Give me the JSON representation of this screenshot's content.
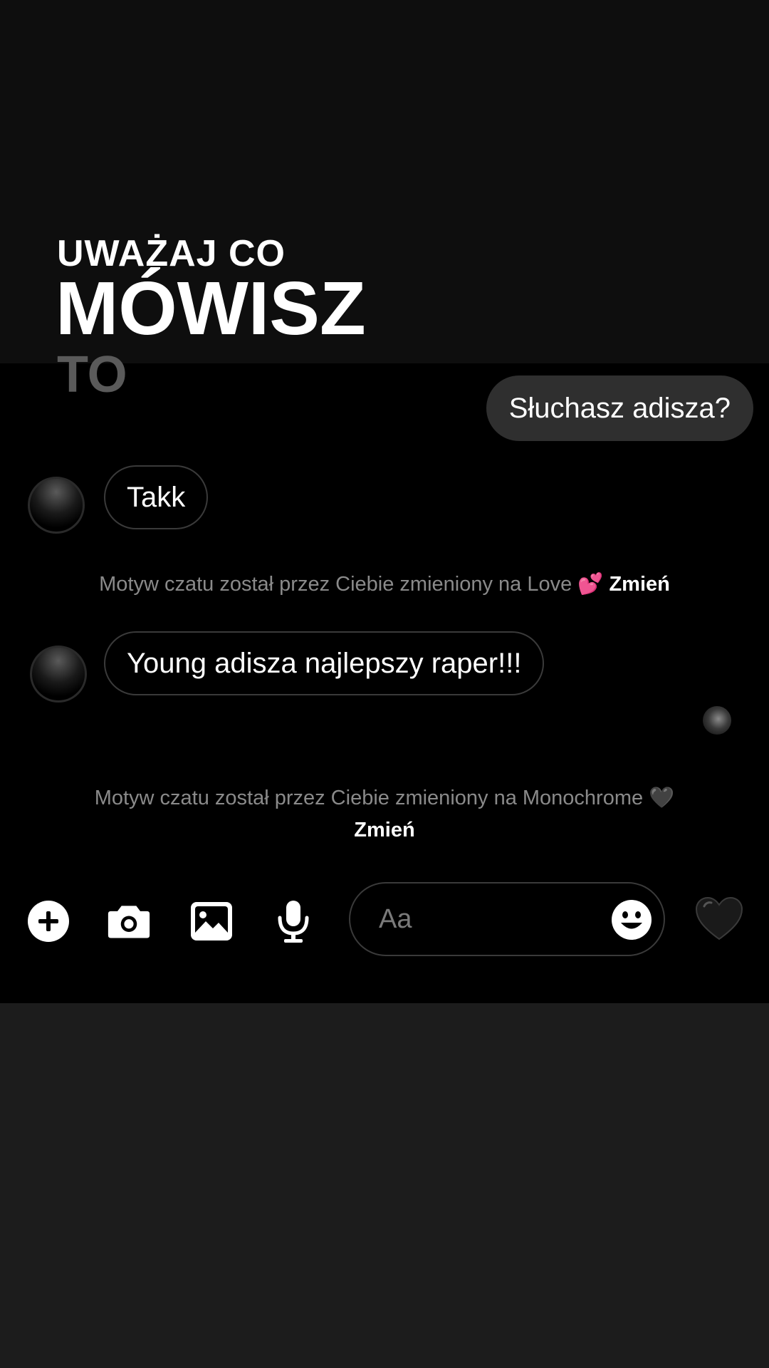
{
  "overlay": {
    "line1": "UWAŻAJ CO",
    "line2": "MÓWISZ",
    "line3": "TO"
  },
  "messages": [
    {
      "direction": "outgoing",
      "text": "Słuchasz adisza?"
    },
    {
      "direction": "incoming",
      "text": "Takk"
    },
    {
      "direction": "incoming",
      "text": "Young adisza najlepszy raper!!!"
    }
  ],
  "system_messages": [
    {
      "text": "Motyw czatu został przez Ciebie zmieniony na Love 💕",
      "action": "Zmień"
    },
    {
      "text": "Motyw czatu został przez Ciebie zmieniony na Monochrome 🖤",
      "action": "Zmień"
    }
  ],
  "composer": {
    "placeholder": "Aa",
    "icons": [
      "plus-circle-icon",
      "camera-icon",
      "image-icon",
      "microphone-icon",
      "emoji-icon",
      "black-heart-icon"
    ]
  },
  "colors": {
    "background": "#000000",
    "outgoing_bubble": "#2f2f2f",
    "system_text": "#8a8a8a",
    "overlay_faded": "#5a5a5a"
  }
}
